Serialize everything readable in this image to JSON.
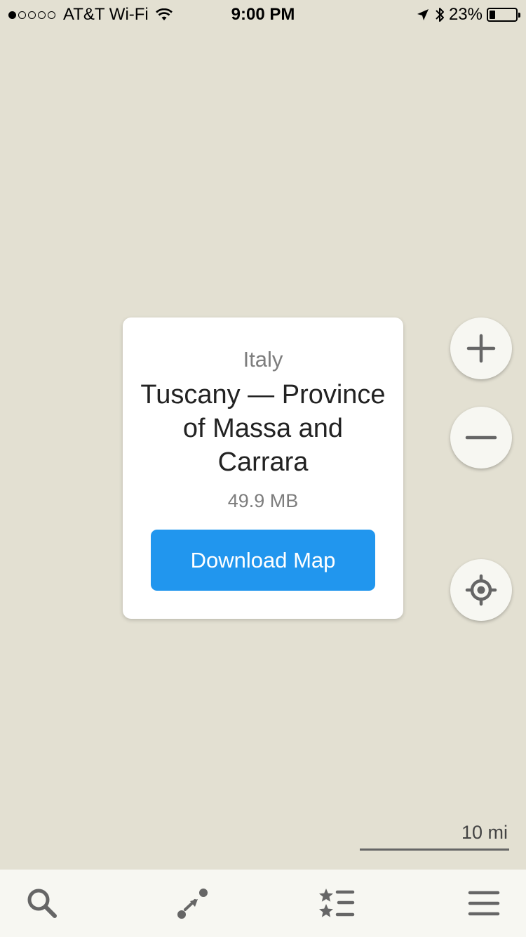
{
  "status_bar": {
    "signal_bars_filled": 1,
    "signal_bars_total": 5,
    "carrier": "AT&T Wi-Fi",
    "time": "9:00 PM",
    "battery_percent": "23%",
    "battery_level": 0.23
  },
  "download_card": {
    "country": "Italy",
    "region": "Tuscany — Province of Massa and Carrara",
    "size": "49.9 MB",
    "button_label": "Download Map"
  },
  "map_controls": {
    "zoom_in_icon": "plus-icon",
    "zoom_out_icon": "minus-icon",
    "my_location_icon": "crosshair-icon"
  },
  "scale": {
    "label": "10 mi"
  },
  "tab_bar": {
    "items": [
      {
        "icon": "search-icon"
      },
      {
        "icon": "route-icon"
      },
      {
        "icon": "bookmarks-icon"
      },
      {
        "icon": "menu-icon"
      }
    ]
  },
  "colors": {
    "map_background": "#e3e0d2",
    "accent": "#2196ee",
    "card_background": "#ffffff",
    "icon_gray": "#666666"
  }
}
